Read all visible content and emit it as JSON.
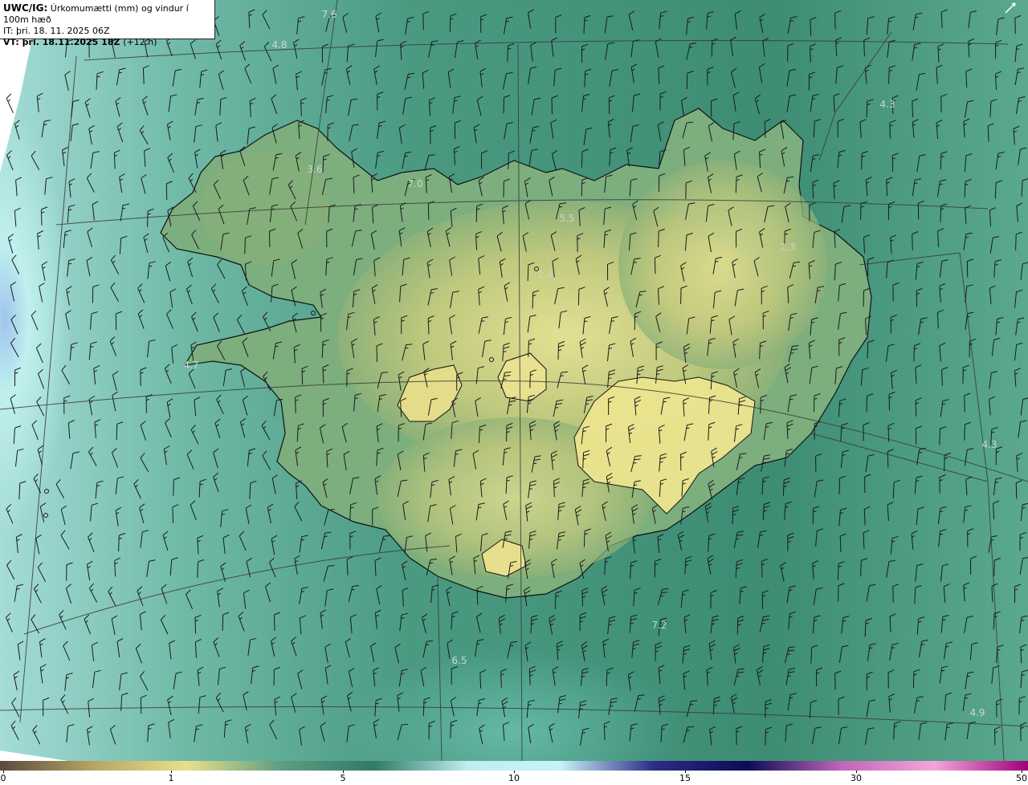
{
  "header": {
    "product": "UWC/IG:",
    "description": "Úrkomumætti (mm) og vindur í 100m hæð",
    "init_label": "IT:",
    "init_time": "þri. 18. 11. 2025 06Z",
    "valid_label": "VT:",
    "valid_time": "þri. 18.11.2025 18Z",
    "lead_time": "(+12 h)"
  },
  "value_labels": [
    "7.6",
    "4.8",
    "3.6",
    "7.0",
    "5.5",
    "2.4",
    "2.3",
    "4.3",
    "4.7",
    "4.3",
    "7.2",
    "6.5",
    "4.9"
  ],
  "colorbar": {
    "ticks": [
      "0",
      "1",
      "5",
      "10",
      "15",
      "30",
      "50"
    ],
    "tick_values": [
      0,
      1,
      5,
      10,
      15,
      30,
      50
    ],
    "colors": [
      "#5b4a3e",
      "#b7a565",
      "#e8e08a",
      "#5f9e82",
      "#2f7a68",
      "#bfeeee",
      "#c8f3f6",
      "#2c2c88",
      "#0c0c55",
      "#bf66b8",
      "#f3a6da",
      "#a0007a"
    ]
  },
  "map": {
    "sea_color": "#3f8f78",
    "land_color": "#b9c47a",
    "highland_color": "#e3dc88",
    "west_sea_color": "#b6ecea",
    "far_west_color": "#8fb9e6",
    "coastline_color": "#111111",
    "grid_color": "#3a3a3a",
    "barb_color": "#1a1a1a"
  }
}
